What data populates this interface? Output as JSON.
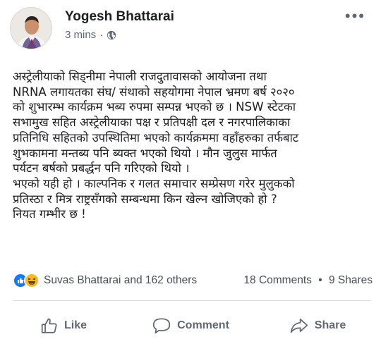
{
  "post": {
    "author": "Yogesh Bhattarai",
    "time": "3 mins",
    "privacy_icon": "globe-icon",
    "text_lines": [
      "अस्ट्रेलीयाको सिड्नीमा नेपाली राजदुतावासको आयोजना तथा",
      "NRNA लगायतका संघ/ संथाको सहयोगमा नेपाल भ्रमण बर्ष २०२०",
      "को शुभारम्भ कार्यक्रम भब्य रुपमा सम्पन्न भएको छ । NSW स्टेटका",
      "सभामुख सहित अस्ट्रेलीयाका पक्ष र प्रतिपक्षी दल र नगरपालिकाका",
      "प्रतिनिधि सहितको उपस्थितिमा भएको कार्यक्रममा वहाँहरुका तर्फबाट",
      "शुभकामना   मन्तब्य पनि ब्यक्त भएको थियो । मौन जुलुस मार्फत",
      "पर्यटन बर्षको प्रबर्द्धन पनि गरिएको थियो ।",
      "भएको यही हो । काल्पनिक र गलत समाचार सम्प्रेसण गरेर मुलुकको",
      "प्रतिस्ठा र मित्र राष्ट्रसँगको सम्बन्धमा किन खेल्न खोजिएको हो ?",
      "नियत गम्भीर छ !"
    ]
  },
  "reactions": {
    "icons": [
      "like-reaction-icon",
      "haha-reaction-icon"
    ],
    "colors": {
      "like": "#1877f2",
      "haha": "#f7b928"
    },
    "summary": "Suvas Bhattarai and 162 others",
    "comments": "18 Comments",
    "shares": "9 Shares"
  },
  "actions": {
    "like": "Like",
    "comment": "Comment",
    "share": "Share"
  }
}
